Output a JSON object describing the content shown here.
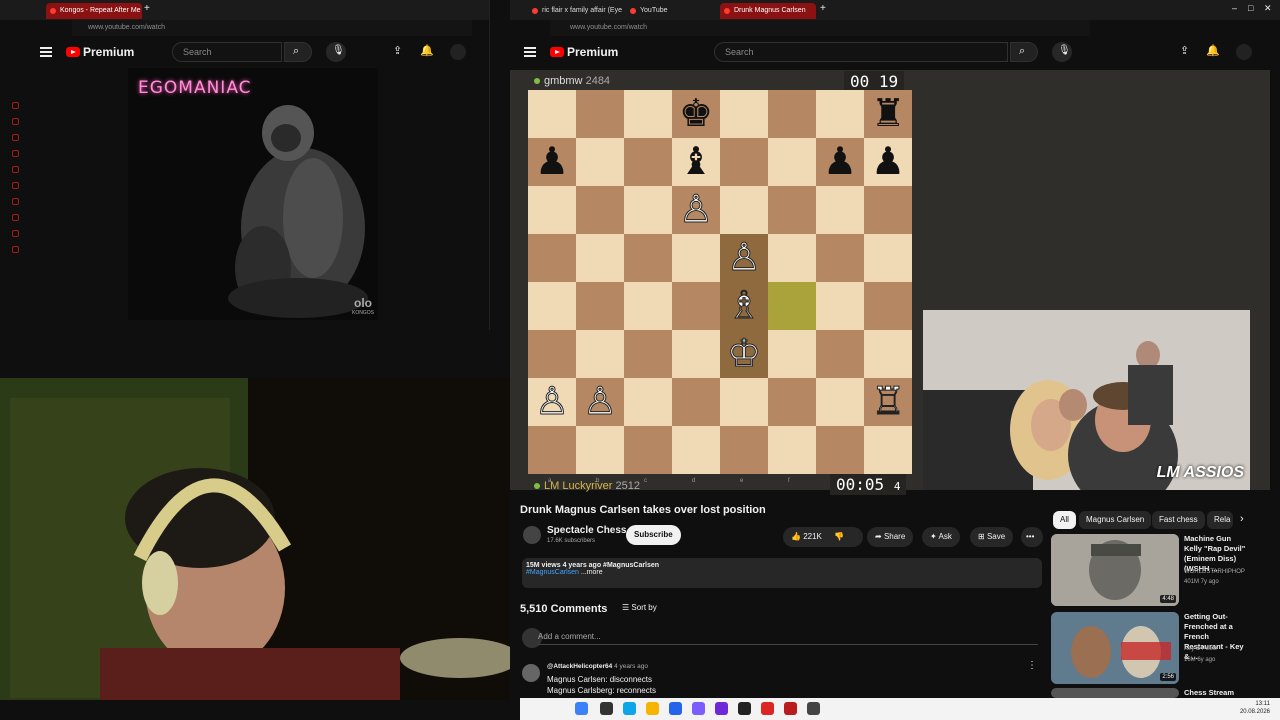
{
  "left_window": {
    "tab_title": "Kongos - Repeat After Me",
    "address": "www.youtube.com/watch",
    "logo": "Premium",
    "search_placeholder": "Search",
    "album_title": "EGOMANIAC",
    "album_artist": "KONGOS",
    "album_mark": "olo"
  },
  "right_window": {
    "tabs": [
      "ric flair x family affair (Eye",
      "YouTube",
      "Drunk Magnus Carlsen"
    ],
    "address": "www.youtube.com/watch",
    "logo": "Premium",
    "search_placeholder": "Search"
  },
  "chess": {
    "top_player": "gmbmw",
    "top_rating": "2484",
    "top_clock": "00 19",
    "bottom_player": "LM Luckyriver",
    "bottom_rating": "2512",
    "bottom_clock": "00:05",
    "bottom_clock_tenths": "4",
    "files": [
      "a",
      "b",
      "c",
      "d",
      "e",
      "f",
      "g",
      "h"
    ],
    "pieces": [
      {
        "sq": "d8",
        "glyph": "♚",
        "color": "b"
      },
      {
        "sq": "h8",
        "glyph": "♜",
        "color": "b"
      },
      {
        "sq": "a7",
        "glyph": "♟",
        "color": "b"
      },
      {
        "sq": "d7",
        "glyph": "♝",
        "color": "b"
      },
      {
        "sq": "g7",
        "glyph": "♟",
        "color": "b"
      },
      {
        "sq": "h7",
        "glyph": "♟",
        "color": "b"
      },
      {
        "sq": "d6",
        "glyph": "♙",
        "color": "w"
      },
      {
        "sq": "e5",
        "glyph": "♙",
        "color": "w"
      },
      {
        "sq": "e4",
        "glyph": "♗",
        "color": "w"
      },
      {
        "sq": "e3",
        "glyph": "♔",
        "color": "w"
      },
      {
        "sq": "a2",
        "glyph": "♙",
        "color": "w"
      },
      {
        "sq": "b2",
        "glyph": "♙",
        "color": "w"
      },
      {
        "sq": "h2",
        "glyph": "♖",
        "color": "w"
      }
    ],
    "highlights": [
      {
        "sq": "f4",
        "cls": "hl"
      },
      {
        "sq": "e5",
        "cls": "hl2"
      },
      {
        "sq": "e4",
        "cls": "hl2"
      },
      {
        "sq": "e3",
        "cls": "hl2"
      }
    ]
  },
  "stream_overlay": "LM ASSIOS",
  "video": {
    "title": "Drunk Magnus Carlsen takes over lost position",
    "channel": "Spectacle Chess",
    "subscribers": "17.6K subscribers",
    "subscribe_label": "Subscribe",
    "likes": "221K",
    "share_label": "Share",
    "ask_label": "Ask",
    "save_label": "Save",
    "views": "15M views  4 years ago  #MagnusCarlsen",
    "hashtag": "#MagnusCarlsen",
    "more": "...more",
    "comments_count": "5,510 Comments",
    "sort_label": "Sort by",
    "add_comment": "Add a comment...",
    "comment_author": "@AttackHelicopter64",
    "comment_age": "4 years ago",
    "comment_line1": "Magnus Carlsen: disconnects",
    "comment_line2": "Magnus Carlsberg: reconnects"
  },
  "chips": [
    "All",
    "Magnus Carlsen",
    "Fast chess",
    "Rela"
  ],
  "recommendations": [
    {
      "title": "Machine Gun Kelly \"Rap Devil\" (Eminem Diss) (WSHH ...",
      "channel": "WORLDSTARHIPHOP",
      "meta": "401M  7y ago",
      "duration": "4:48"
    },
    {
      "title": "Getting Out-Frenched at a French Restaurant - Key & ...",
      "channel": "Key & Peele",
      "meta": "16M  6y ago",
      "duration": "2:56"
    },
    {
      "title": "Chess Stream",
      "channel": "",
      "meta": "",
      "duration": ""
    }
  ],
  "taskbar": {
    "time": "13:11",
    "date": "20.08.2026"
  },
  "colors": {
    "accent": "#ff0000",
    "board_light": "#f0d9b5",
    "board_dark": "#b58863"
  }
}
